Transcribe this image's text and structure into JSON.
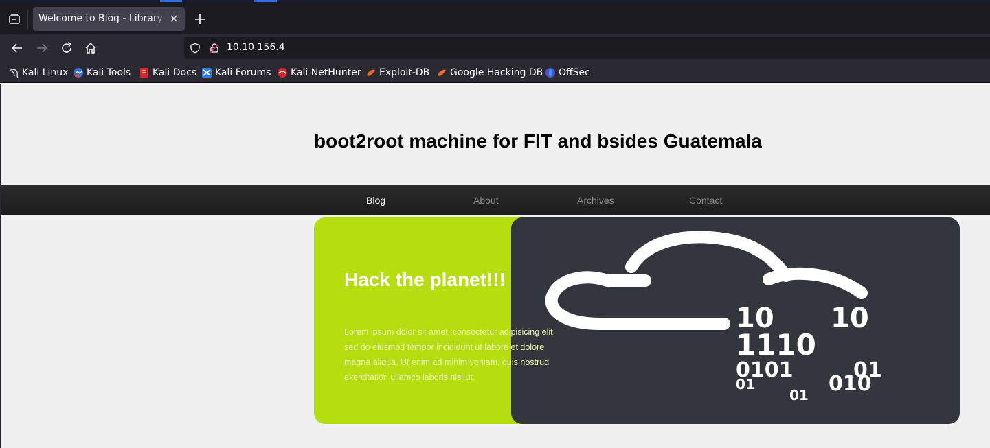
{
  "browser": {
    "tab": {
      "title": "Welcome to Blog - Library M"
    },
    "url": "10.10.156.4",
    "bookmarks": [
      {
        "label": "Kali Linux",
        "icon": "kali-dragon-icon"
      },
      {
        "label": "Kali Tools",
        "icon": "kali-tools-icon"
      },
      {
        "label": "Kali Docs",
        "icon": "kali-docs-icon"
      },
      {
        "label": "Kali Forums",
        "icon": "kali-forums-icon"
      },
      {
        "label": "Kali NetHunter",
        "icon": "kali-nethunter-icon"
      },
      {
        "label": "Exploit-DB",
        "icon": "exploit-db-icon"
      },
      {
        "label": "Google Hacking DB",
        "icon": "ghdb-icon"
      },
      {
        "label": "OffSec",
        "icon": "offsec-icon"
      }
    ]
  },
  "site": {
    "title": "boot2root machine for FIT and bsides Guatemala",
    "nav": [
      {
        "label": "Blog",
        "active": true
      },
      {
        "label": "About",
        "active": false
      },
      {
        "label": "Archives",
        "active": false
      },
      {
        "label": "Contact",
        "active": false
      }
    ],
    "hero": {
      "heading": "Hack the planet!!!",
      "text": "Lorem ipsum dolor sit amet, consectetur adipisicing elit, sed do eiusmod tempor incididunt ut labore et dolore magna aliqua. Ut enim ad minim veniam, quis nostrud exercitation ullamco laboris nisi ut.",
      "binary_lines": [
        "10",
        "10",
        "1110",
        "0101",
        "01",
        "01",
        "010",
        "01"
      ]
    }
  },
  "colors": {
    "hero_green": "#b5dd0f",
    "hero_dark": "#33373d",
    "nav_bg": "#222222"
  }
}
